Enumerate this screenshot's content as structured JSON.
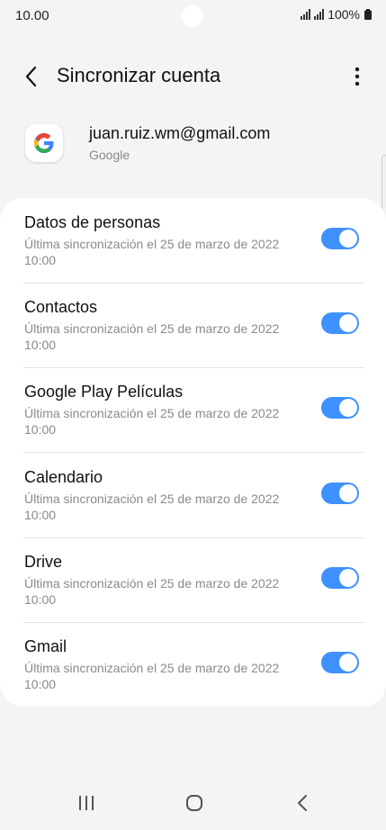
{
  "status_bar": {
    "time": "10.00",
    "battery": "100%"
  },
  "header": {
    "title": "Sincronizar cuenta",
    "back_icon": "chevron-left-icon",
    "more_icon": "more-vertical-icon"
  },
  "account": {
    "email": "juan.ruiz.wm@gmail.com",
    "provider": "Google",
    "logo_icon": "google-g-icon"
  },
  "sync_items": [
    {
      "title": "Datos de personas",
      "subtitle": "Última sincronización el 25 de marzo de 2022 10:00",
      "enabled": true
    },
    {
      "title": "Contactos",
      "subtitle": "Última sincronización el 25 de marzo de 2022 10:00",
      "enabled": true
    },
    {
      "title": "Google Play Películas",
      "subtitle": "Última sincronización el 25 de marzo de 2022 10:00",
      "enabled": true
    },
    {
      "title": "Calendario",
      "subtitle": "Última sincronización el 25 de marzo de 2022 10:00",
      "enabled": true
    },
    {
      "title": "Drive",
      "subtitle": "Última sincronización el 25 de marzo de 2022 10:00",
      "enabled": true
    },
    {
      "title": "Gmail",
      "subtitle": "Última sincronización el 25 de marzo de 2022 10:00",
      "enabled": true
    }
  ],
  "nav_bar": {
    "recents_icon": "recents-icon",
    "home_icon": "home-icon",
    "back_icon": "back-icon"
  },
  "colors": {
    "toggle_on": "#3e91ff",
    "background": "#f4f4f4",
    "card": "#ffffff"
  }
}
